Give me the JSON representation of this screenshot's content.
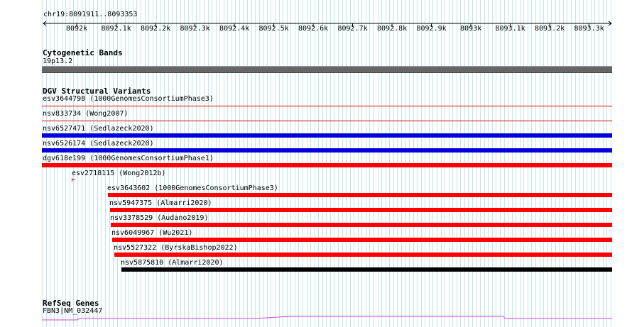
{
  "ruler": {
    "position": "chr19:8091911..8093353",
    "ticks": [
      "8092k",
      "8092.1k",
      "8092.2k",
      "8092.3k",
      "8092.4k",
      "8092.5k",
      "8092.6k",
      "8092.7k",
      "8092.8k",
      "8092.9k",
      "8093k",
      "8093.1k",
      "8093.2k",
      "8093.3k"
    ]
  },
  "cytoband": {
    "title": "Cytogenetic Bands",
    "band": "19p13.2",
    "color": "#666666"
  },
  "dgv": {
    "title": "DGV Structural Variants",
    "features": [
      {
        "label": "esv3644798 (1000GenomesConsortiumPhase3)",
        "color": "#dd0000",
        "style": "thin"
      },
      {
        "label": "nsv833734 (Wong2007)",
        "color": "#dd0000",
        "style": "thin"
      },
      {
        "label": "nsv6527471 (Sedlazeck2020)",
        "color": "#0000dd",
        "style": "thick"
      },
      {
        "label": "nsv6526174 (Sedlazeck2020)",
        "color": "#0000dd",
        "style": "thick"
      },
      {
        "label": "dgv618e199 (1000GenomesConsortiumPhase1)",
        "color": "#ff0000",
        "style": "thick"
      },
      {
        "label": "esv2718115 (Wong2012b)",
        "color": "#ff0000",
        "style": "tick"
      },
      {
        "label": "esv3643602 (1000GenomesConsortiumPhase3)",
        "color": "#ff0000",
        "style": "thick"
      },
      {
        "label": "nsv5947375 (Almarri2020)",
        "color": "#ff0000",
        "style": "thick"
      },
      {
        "label": "nsv3378529 (Audano2019)",
        "color": "#ff0000",
        "style": "thick"
      },
      {
        "label": "nsv6049967 (Wu2021)",
        "color": "#ff0000",
        "style": "thick"
      },
      {
        "label": "nsv5527322 (ByrskaBishop2022)",
        "color": "#ff0000",
        "style": "thick"
      },
      {
        "label": "nsv5875810 (Almarri2020)",
        "color": "#000000",
        "style": "thick"
      }
    ]
  },
  "refseq": {
    "title": "RefSeq Genes",
    "gene": "FBN3|NM_032447",
    "color": "#cc44cc"
  }
}
